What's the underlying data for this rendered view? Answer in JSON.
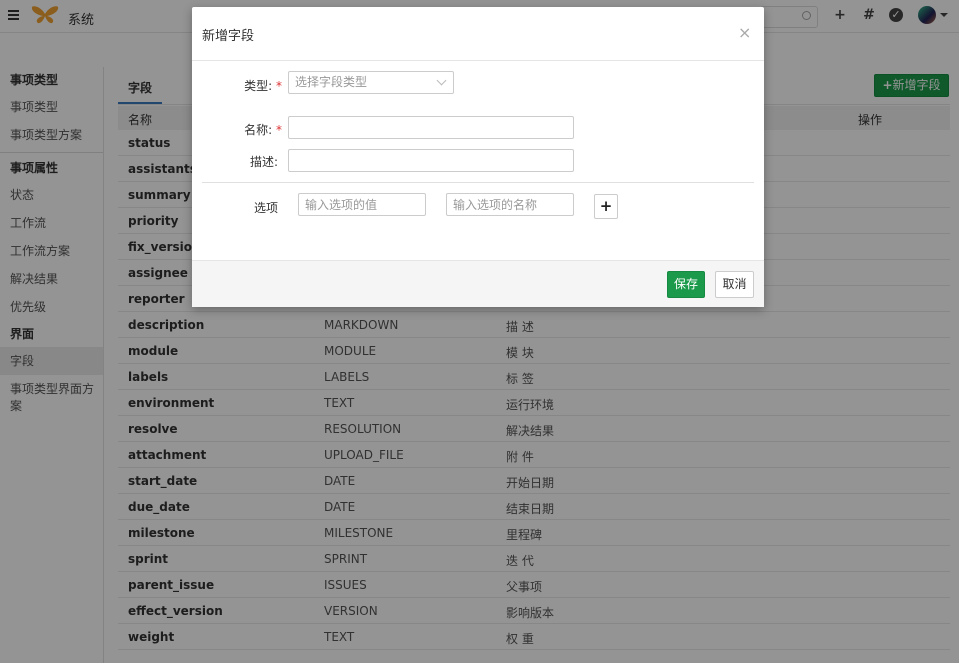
{
  "header": {
    "system_label": "系统",
    "icons": [
      "menu-icon",
      "butterfly-logo-icon",
      "search-icon",
      "plus-icon",
      "hash-icon",
      "check-circle-icon",
      "avatar",
      "chevron-down-icon"
    ],
    "plus_glyph": "+",
    "hash_glyph": "#",
    "check_glyph": "✓"
  },
  "sidebar": {
    "group1": "事项类型",
    "group1_items": [
      "事项类型",
      "事项类型方案"
    ],
    "group2": "事项属性",
    "group2_items": [
      "状态",
      "工作流",
      "工作流方案",
      "解决结果",
      "优先级"
    ],
    "group3": "界面",
    "group3_items": [
      "字段",
      "事项类型界面方案"
    ],
    "active_item": "字段"
  },
  "main": {
    "tab_label": "字段",
    "add_button_label": "新增字段",
    "add_button_glyph": "+",
    "columns": {
      "name": "名称",
      "action": "操作"
    },
    "rows": [
      {
        "name": "status",
        "type": "",
        "desc": ""
      },
      {
        "name": "assistants",
        "type": "",
        "desc": ""
      },
      {
        "name": "summary",
        "type": "",
        "desc": ""
      },
      {
        "name": "priority",
        "type": "",
        "desc": ""
      },
      {
        "name": "fix_version",
        "type": "",
        "desc": ""
      },
      {
        "name": "assignee",
        "type": "",
        "desc": ""
      },
      {
        "name": "reporter",
        "type": "",
        "desc": ""
      },
      {
        "name": "description",
        "type": "MARKDOWN",
        "desc": "描 述"
      },
      {
        "name": "module",
        "type": "MODULE",
        "desc": "模 块"
      },
      {
        "name": "labels",
        "type": "LABELS",
        "desc": "标 签"
      },
      {
        "name": "environment",
        "type": "TEXT",
        "desc": "运行环境"
      },
      {
        "name": "resolve",
        "type": "RESOLUTION",
        "desc": "解决结果"
      },
      {
        "name": "attachment",
        "type": "UPLOAD_FILE",
        "desc": "附 件"
      },
      {
        "name": "start_date",
        "type": "DATE",
        "desc": "开始日期"
      },
      {
        "name": "due_date",
        "type": "DATE",
        "desc": "结束日期"
      },
      {
        "name": "milestone",
        "type": "MILESTONE",
        "desc": "里程碑"
      },
      {
        "name": "sprint",
        "type": "SPRINT",
        "desc": "迭 代"
      },
      {
        "name": "parent_issue",
        "type": "ISSUES",
        "desc": "父事项"
      },
      {
        "name": "effect_version",
        "type": "VERSION",
        "desc": "影响版本"
      },
      {
        "name": "weight",
        "type": "TEXT",
        "desc": "权 重"
      }
    ]
  },
  "modal": {
    "title": "新增字段",
    "close_glyph": "×",
    "type_label": "类型:",
    "type_placeholder": "选择字段类型",
    "name_label": "名称:",
    "required_mark": "*",
    "name_value": "",
    "desc_label": "描述:",
    "desc_value": "",
    "options_label": "选项",
    "option_value_placeholder": "输入选项的值",
    "option_name_placeholder": "输入选项的名称",
    "add_option_glyph": "+",
    "save_label": "保存",
    "cancel_label": "取消"
  },
  "colors": {
    "primary_green": "#1a9a4a",
    "tab_underline": "#3b7bbf",
    "required_red": "#dd3333"
  }
}
